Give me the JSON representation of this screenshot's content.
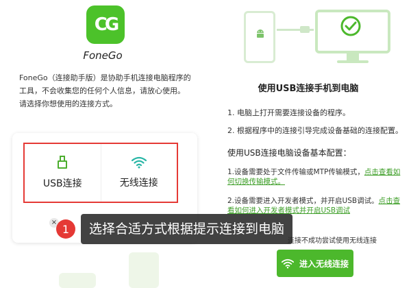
{
  "left": {
    "logo_text": "CG",
    "app_name": "FoneGo",
    "description": "FoneGo（连接助手版）是协助手机连接电脑程序的工具，不会收集您的任何个人信息，请放心使用。请选择你想使用的连接方式。",
    "options": {
      "usb_label": "USB连接",
      "wifi_label": "无线连接"
    },
    "close_glyph": "×"
  },
  "right": {
    "title": "使用USB连接手机到电脑",
    "steps": [
      "1.  电脑上打开需要连接设备的程序。",
      "2.  根据程序中的连接引导完成设备基础的连接配置。"
    ],
    "config_title": "使用USB连接电脑设备基本配置：",
    "config_1_text": "1.设备需要处于文件传输或MTP传输模式，",
    "config_1_link": "点击查看如何切换传输模式。",
    "config_2_text": "2.设备需要进入开发者模式，并开启USB调试。",
    "config_2_link": "点击查看如何进入开发者模式并开启USB调试",
    "fail_text": "连接不成功尝试使用无线连接",
    "wifi_button_label": "进入无线连接"
  },
  "overlay": {
    "step_number": "1",
    "text": "选择合适方式根据提示连接到电脑"
  },
  "colors": {
    "brand_green": "#4cc22a",
    "highlight_red": "#e53935"
  },
  "icons": [
    "usb-icon",
    "wifi-icon",
    "android-icon",
    "checkmark-icon"
  ]
}
